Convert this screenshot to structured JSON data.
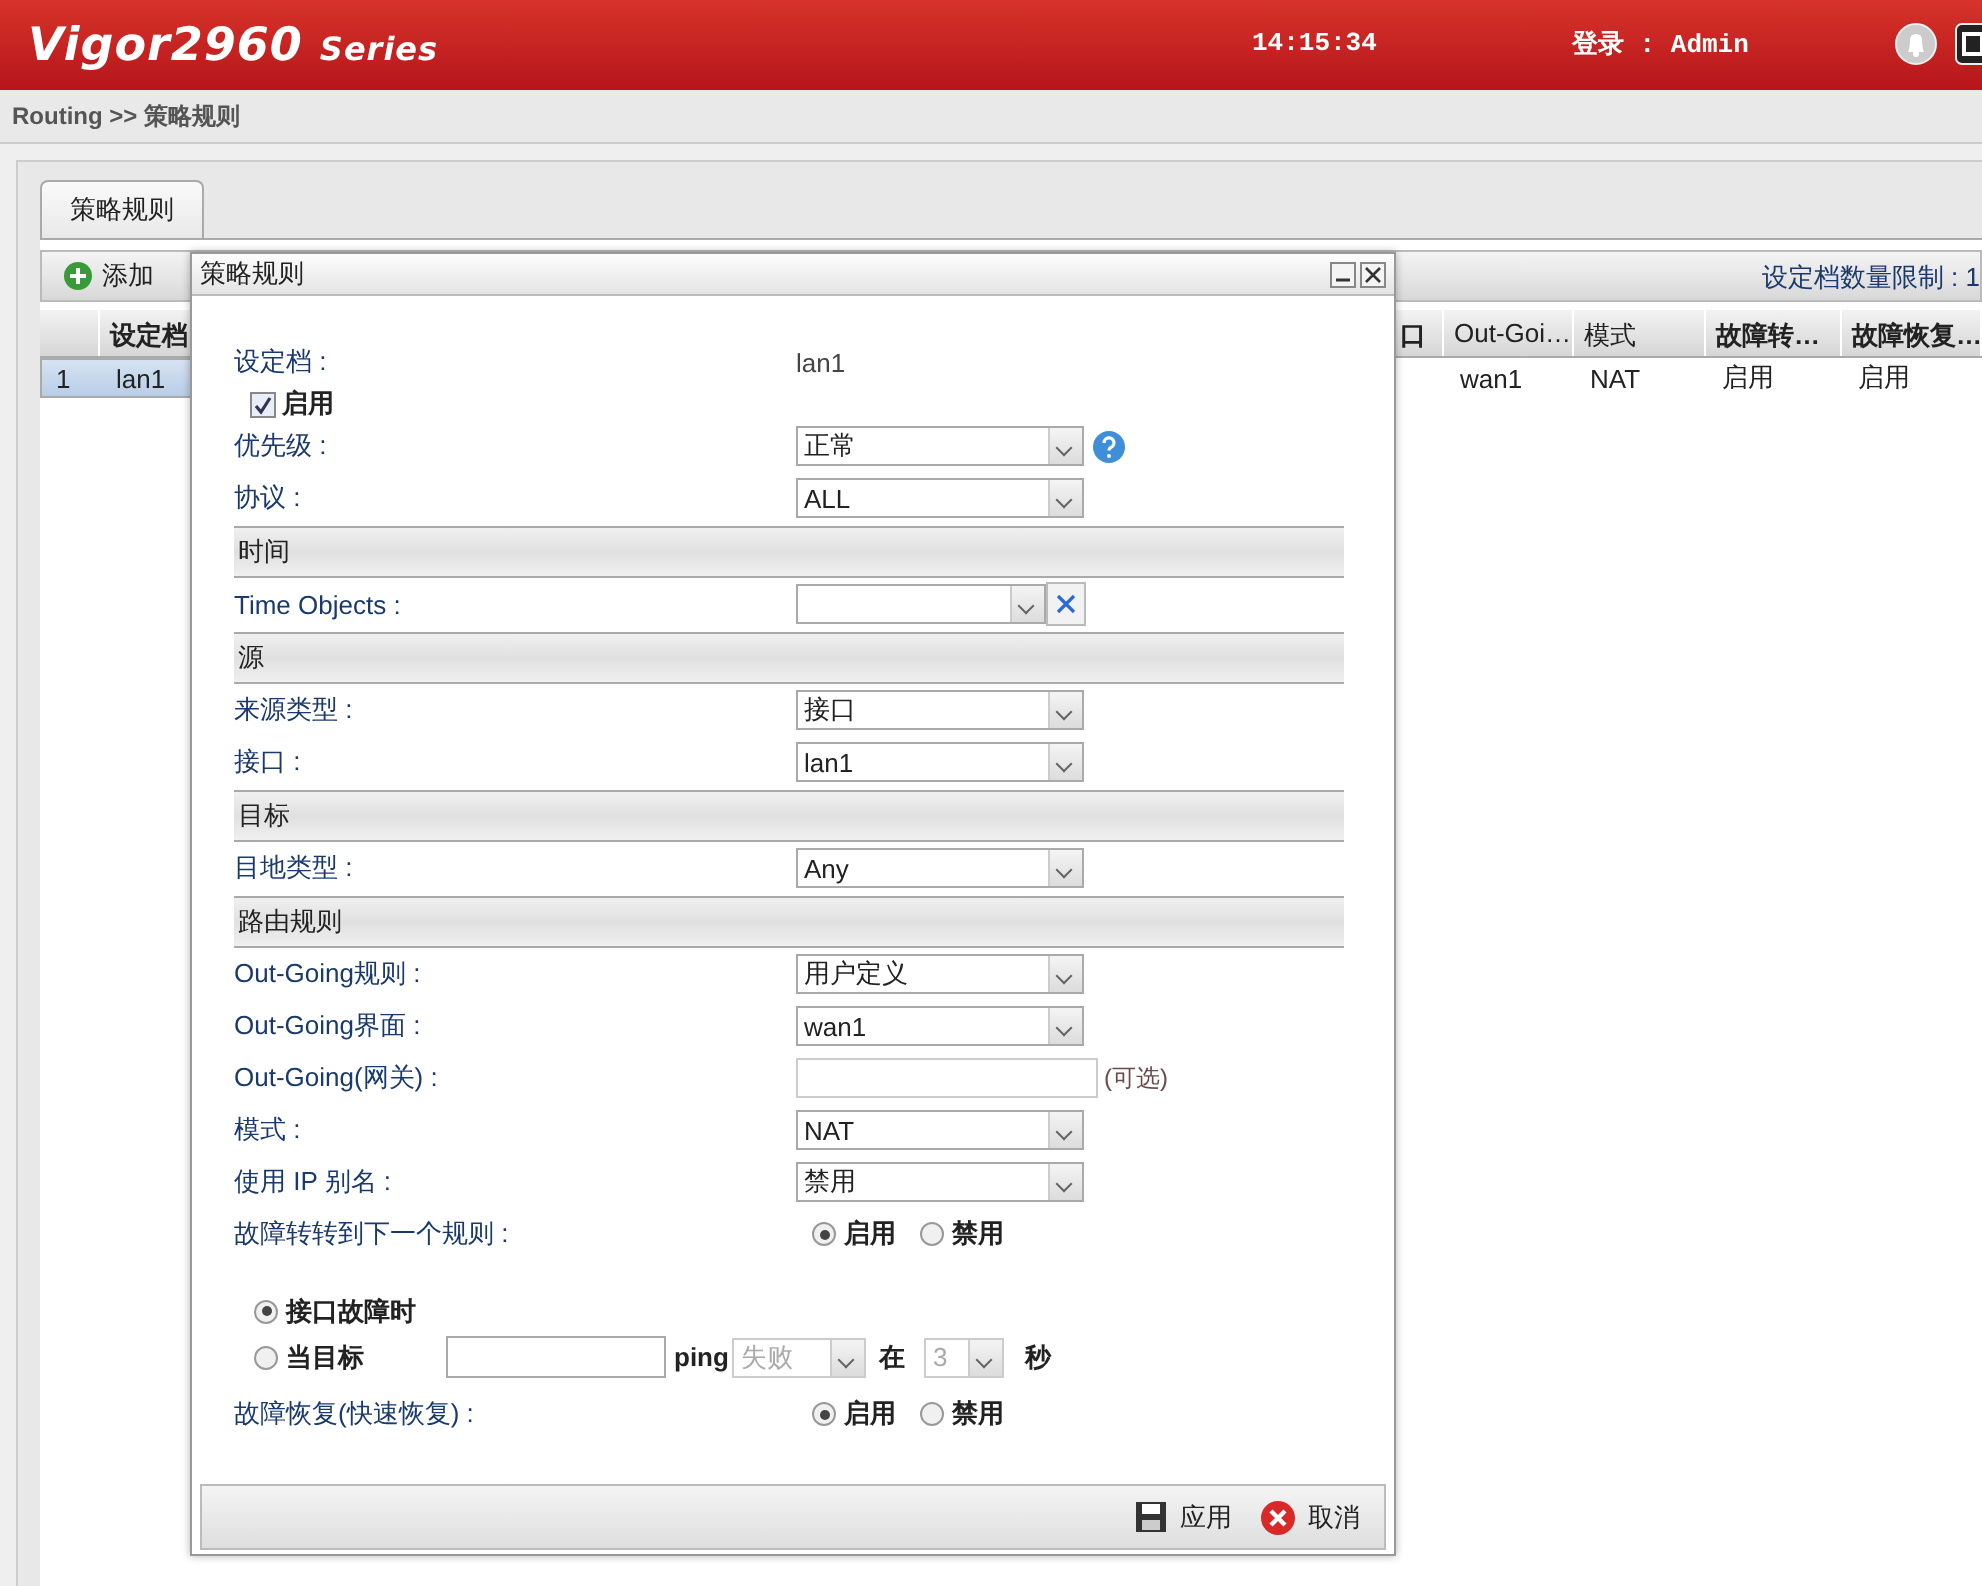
{
  "header": {
    "logo": "Vigor2960",
    "series": "Series",
    "time": "14:15:34",
    "login": "登录 : Admin"
  },
  "breadcrumb": "Routing >> 策略规则",
  "tabs": [
    {
      "label": "策略规则",
      "selected": true
    }
  ],
  "toolbar": {
    "buttons": [
      {
        "label": "添加",
        "kind": "add"
      }
    ],
    "limit": "设定档数量限制 : 1"
  },
  "table": {
    "columns": [
      {},
      {
        "label": "设定档"
      },
      {
        "label": "口"
      },
      {
        "label": "Out-Goi…"
      },
      {
        "label": "模式"
      },
      {
        "label": "故障转…"
      },
      {
        "label": "故障恢复…"
      }
    ],
    "rows": [
      {
        "selected": true,
        "cells": [
          "1",
          "lan1",
          "",
          "wan1",
          "NAT",
          "启用",
          "启用"
        ]
      }
    ]
  },
  "dialog": {
    "title": "策略规则",
    "footer": [
      {
        "label": "应用",
        "kind": "save"
      },
      {
        "label": "取消",
        "kind": "cancel"
      }
    ],
    "fields": [
      {
        "kind": "value",
        "label": "设定档 :",
        "value": "lan1"
      },
      {
        "kind": "checkbox",
        "label": "启用",
        "checked": true
      },
      {
        "kind": "select",
        "label": "优先级 :",
        "value": "正常",
        "help": true
      },
      {
        "kind": "select",
        "label": "协议 :",
        "value": "ALL"
      },
      {
        "kind": "section",
        "label": "时间"
      },
      {
        "kind": "clearable",
        "label": "Time Objects :"
      },
      {
        "kind": "section",
        "label": "源"
      },
      {
        "kind": "select",
        "label": "来源类型 :",
        "value": "接口"
      },
      {
        "kind": "select",
        "label": "接口 :",
        "value": "lan1"
      },
      {
        "kind": "section",
        "label": "目标"
      },
      {
        "kind": "select",
        "label": "目地类型 :",
        "value": "Any"
      },
      {
        "kind": "section",
        "label": "路由规则"
      },
      {
        "kind": "select",
        "label": "Out-Going规则 :",
        "value": "用户定义"
      },
      {
        "kind": "select",
        "label": "Out-Going界面 :",
        "value": "wan1"
      },
      {
        "kind": "input",
        "label": "Out-Going(网关) :",
        "note": "(可选)"
      },
      {
        "kind": "select",
        "label": "模式 :",
        "value": "NAT"
      },
      {
        "kind": "select",
        "label": "使用 IP 别名 :",
        "value": "禁用"
      },
      {
        "kind": "radio",
        "label": "故障转转到下一个规则 :",
        "options": [
          {
            "label": "启用",
            "selected": true
          },
          {
            "label": "禁用",
            "selected": false
          }
        ]
      },
      {
        "kind": "trigger",
        "options": [
          {
            "label": "接口故障时",
            "selected": true
          },
          {
            "label": "当目标",
            "selected": false
          }
        ],
        "ping": "ping",
        "result": "失败",
        "within": "在",
        "seconds": "3",
        "unit": "秒",
        "disabled": true
      },
      {
        "kind": "radio",
        "label": "故障恢复(快速恢复) :",
        "options": [
          {
            "label": "启用",
            "selected": true
          },
          {
            "label": "禁用",
            "selected": false
          }
        ]
      }
    ]
  }
}
